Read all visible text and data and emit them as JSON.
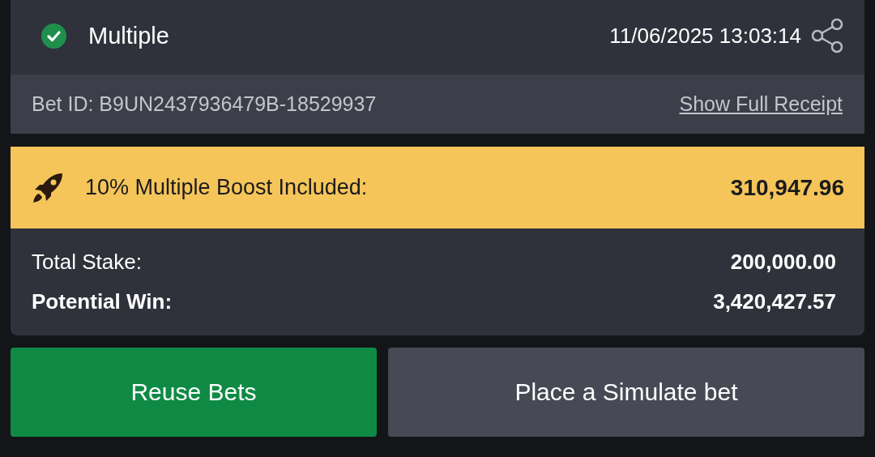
{
  "bet": {
    "type": "Multiple",
    "settled": true,
    "datetime": "11/06/2025 13:03:14",
    "bet_id": "Bet ID: B9UN2437936479B-18529937",
    "receipt_link": "Show Full Receipt"
  },
  "boost": {
    "label": "10% Multiple Boost Included:",
    "amount": "310,947.96"
  },
  "totals": [
    {
      "label": "Total Stake:",
      "value": "200,000.00",
      "emphasis": false
    },
    {
      "label": "Potential Win:",
      "value": "3,420,427.57",
      "emphasis": true
    }
  ],
  "buttons": [
    {
      "label": "Reuse Bets",
      "kind": "primary"
    },
    {
      "label": "Place a Simulate bet",
      "kind": "secondary"
    }
  ]
}
